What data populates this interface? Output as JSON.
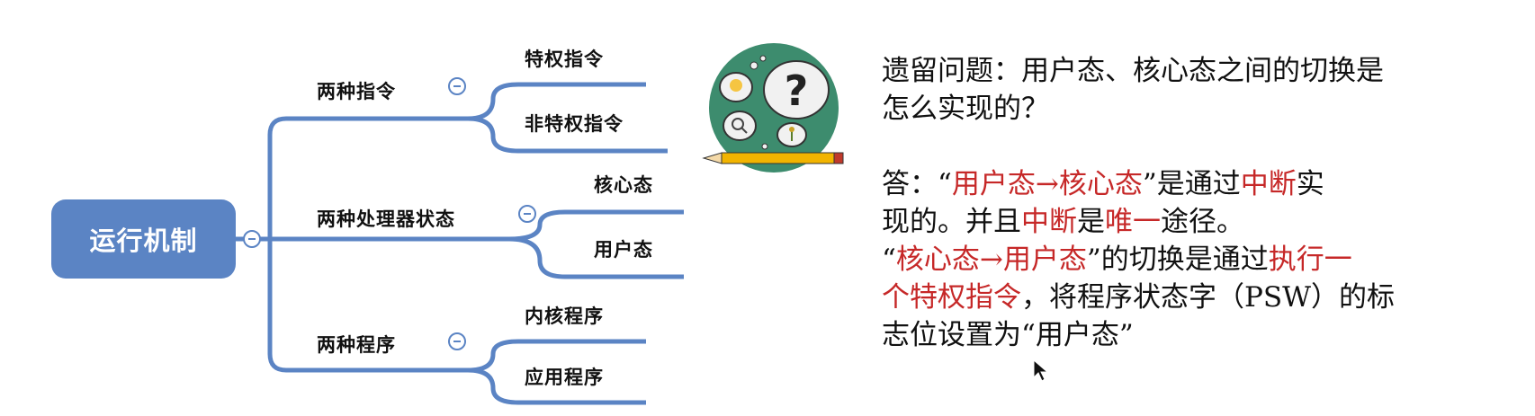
{
  "mindmap": {
    "root": "运行机制",
    "branches": [
      {
        "label": "两种指令",
        "children": [
          "特权指令",
          "非特权指令"
        ]
      },
      {
        "label": "两种处理器状态",
        "children": [
          "核心态",
          "用户态"
        ]
      },
      {
        "label": "两种程序",
        "children": [
          "内核程序",
          "应用程序"
        ]
      }
    ]
  },
  "icon": {
    "name": "question-thinking-icon",
    "bg_color": "#3d8c6e",
    "mark": "?"
  },
  "colors": {
    "accent": "#5b84c4",
    "highlight": "#c62828"
  },
  "question": {
    "line1": "遗留问题：用户态、核心态之间的切换是",
    "line2": "怎么实现的？"
  },
  "answer": {
    "p1": {
      "prefix": "答：“",
      "seg1": "用户态",
      "arrow": "→",
      "seg2": "核心态",
      "mid": "”是通过",
      "hl1": "中断",
      "rest1": "实",
      "line2_start": "现的。并且",
      "hl2": "中断",
      "mid2": "是",
      "hl3": "唯一",
      "end": "途径。"
    },
    "p2": {
      "quote_open": "“",
      "seg1": "核心态",
      "arrow": "→",
      "seg2": "用户态",
      "mid": "”的切换是通过",
      "hl1": "执行一",
      "hl2": "个特权指令",
      "rest": "，将程序状态字（PSW）的标",
      "line3": "志位设置为“用户态”"
    }
  }
}
